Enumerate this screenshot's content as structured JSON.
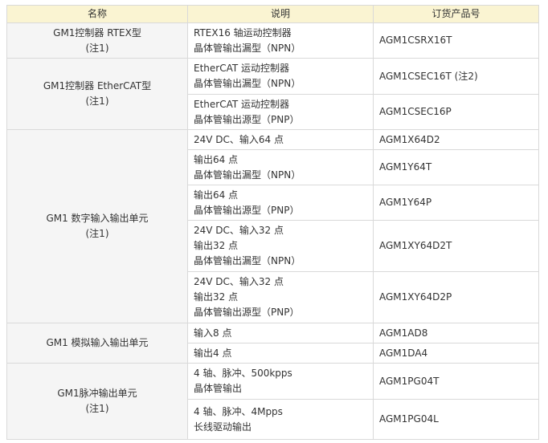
{
  "headers": [
    "名称",
    "说明",
    "订货产品号"
  ],
  "groups": [
    {
      "name": [
        "GM1控制器 RTEX型",
        "(注1)"
      ],
      "rows": [
        {
          "desc": [
            "RTEX16 轴运动控制器",
            "晶体管输出漏型（NPN）"
          ],
          "code": "AGM1CSRX16T"
        }
      ]
    },
    {
      "name": [
        "GM1控制器 EtherCAT型",
        "(注1)"
      ],
      "rows": [
        {
          "desc": [
            "EtherCAT 运动控制器",
            "晶体管输出漏型（NPN）"
          ],
          "code": "AGM1CSEC16T (注2)"
        },
        {
          "desc": [
            "EtherCAT 运动控制器",
            "晶体管输出源型（PNP）"
          ],
          "code": "AGM1CSEC16P"
        }
      ]
    },
    {
      "name": [
        "GM1 数字输入输出单元",
        "(注1)"
      ],
      "rows": [
        {
          "desc": [
            "24V DC、输入64 点"
          ],
          "code": "AGM1X64D2"
        },
        {
          "desc": [
            "输出64 点",
            "晶体管输出漏型（NPN）"
          ],
          "code": "AGM1Y64T"
        },
        {
          "desc": [
            "输出64 点",
            "晶体管输出源型（PNP）"
          ],
          "code": "AGM1Y64P"
        },
        {
          "desc": [
            "24V DC、输入32 点",
            "输出32 点",
            "晶体管输出漏型（NPN）"
          ],
          "code": "AGM1XY64D2T"
        },
        {
          "desc": [
            "24V DC、输入32 点",
            "输出32 点",
            "晶体管输出源型（PNP）"
          ],
          "code": "AGM1XY64D2P"
        }
      ]
    },
    {
      "name": [
        "GM1 模拟输入输出单元"
      ],
      "rows": [
        {
          "desc": [
            "输入8 点"
          ],
          "code": "AGM1AD8"
        },
        {
          "desc": [
            "输出4 点"
          ],
          "code": "AGM1DA4"
        }
      ]
    },
    {
      "name": [
        "GM1脉冲输出单元",
        "(注1)"
      ],
      "rows": [
        {
          "desc": [
            "4 轴、脉冲、500kpps",
            "晶体管输出"
          ],
          "code": "AGM1PG04T"
        },
        {
          "desc": [
            "4 轴、脉冲、4Mpps",
            "长线驱动输出"
          ],
          "code": "AGM1PG04L"
        }
      ]
    }
  ]
}
